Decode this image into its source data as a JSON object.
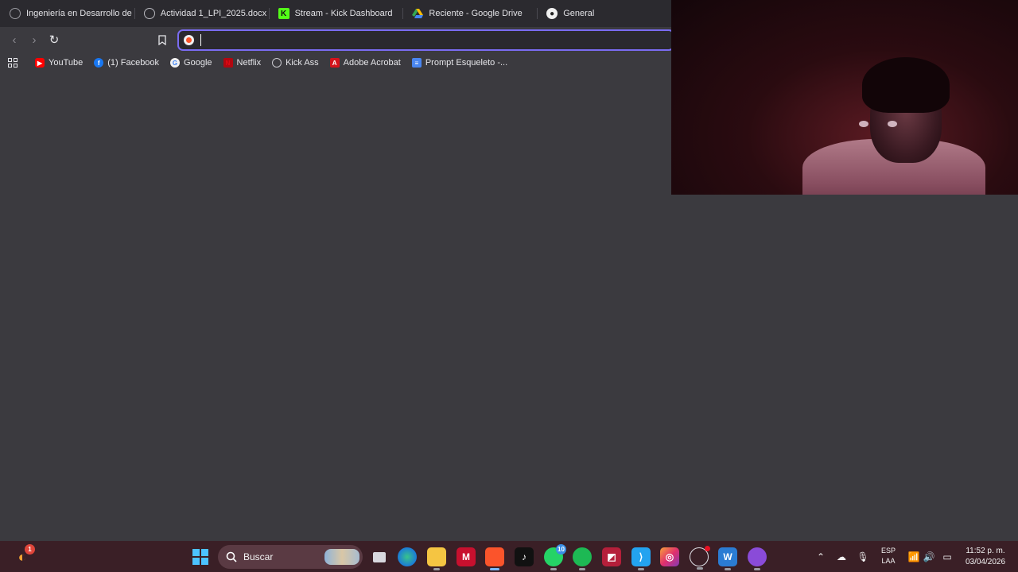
{
  "tabs": [
    {
      "title": "Ingeniería en Desarrollo de Soft",
      "icon": "globe-icon"
    },
    {
      "title": "Actividad 1_LPI_2025.docx",
      "icon": "globe-icon"
    },
    {
      "title": "Stream - Kick Dashboard",
      "icon": "kick-icon"
    },
    {
      "title": "Reciente - Google Drive",
      "icon": "google-drive-icon"
    },
    {
      "title": "General",
      "icon": "github-icon"
    }
  ],
  "omnibox": {
    "value": "",
    "placeholder": ""
  },
  "bookmarks": [
    {
      "label": "YouTube",
      "icon": "youtube-icon"
    },
    {
      "label": "(1) Facebook",
      "icon": "facebook-icon"
    },
    {
      "label": "Google",
      "icon": "google-icon"
    },
    {
      "label": "Netflix",
      "icon": "netflix-icon"
    },
    {
      "label": "Kick Ass",
      "icon": "globe-icon"
    },
    {
      "label": "Adobe Acrobat",
      "icon": "acrobat-icon"
    },
    {
      "label": "Prompt Esqueleto -...",
      "icon": "docs-icon"
    }
  ],
  "taskbar": {
    "search_label": "Buscar",
    "whatsapp_badge": "10",
    "weather_badge": "1",
    "language_top": "ESP",
    "language_bottom": "LAA",
    "time": "11:52 p. m.",
    "date": "03/04/2026"
  },
  "colors": {
    "accent": "#7a6cf2",
    "page_bg": "#3b3a3f",
    "tabbar_bg": "#2b2a2f",
    "taskbar_bg": "#3a1f26"
  }
}
